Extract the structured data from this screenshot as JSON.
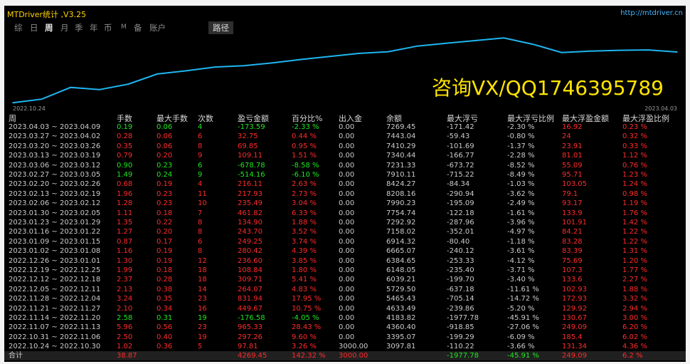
{
  "window": {
    "title": "MTDriver统计 ,V3.25",
    "url": "http://mtdriver.cn"
  },
  "tabs": [
    {
      "label": "综",
      "active": false
    },
    {
      "label": "日",
      "active": false
    },
    {
      "label": "周",
      "active": true
    },
    {
      "label": "月",
      "active": false
    },
    {
      "label": "季",
      "active": false
    },
    {
      "label": "年",
      "active": false
    },
    {
      "label": "币",
      "active": false
    },
    {
      "label": "M",
      "active": false
    },
    {
      "label": "备",
      "active": false
    },
    {
      "label": "账户",
      "active": false
    }
  ],
  "path_button": "路径",
  "chart_data": {
    "type": "line",
    "x_start_label": "2022.10.24",
    "x_end_label": "2023.04.03",
    "line_color": "#1fb5f0",
    "x": [
      "2022.10.24",
      "2022.10.31",
      "2022.11.07",
      "2022.11.14",
      "2022.11.21",
      "2022.11.28",
      "2022.12.05",
      "2022.12.12",
      "2022.12.19",
      "2022.12.26",
      "2023.01.02",
      "2023.01.09",
      "2023.01.16",
      "2023.01.23",
      "2023.01.30",
      "2023.02.06",
      "2023.02.13",
      "2023.02.20",
      "2023.02.27",
      "2023.03.06",
      "2023.03.13",
      "2023.03.20",
      "2023.03.27",
      "2023.04.03"
    ],
    "y": [
      3097.81,
      3395.07,
      4360.4,
      4183.82,
      4633.49,
      5465.43,
      5729.5,
      6039.21,
      6148.05,
      6384.65,
      6665.07,
      6914.32,
      7158.02,
      7292.92,
      7754.74,
      7990.23,
      8208.16,
      8424.27,
      7910.11,
      7231.33,
      7340.44,
      7410.29,
      7443.04,
      7269.45
    ],
    "ylim": [
      3000,
      8500
    ]
  },
  "promo_text": "咨询VX/QQ1746395789",
  "table": {
    "columns": [
      "周",
      "手数",
      "最大手数",
      "次数",
      "盈亏金额",
      "百分比%",
      "出入金",
      "余额",
      "最大浮亏",
      "最大浮亏比例",
      "最大浮盈金额",
      "最大浮盈比例"
    ],
    "rows": [
      {
        "color": "g",
        "cells": [
          "2023.04.03 ~ 2023.04.09",
          "0.19",
          "0.06",
          "4",
          "-173.59",
          "-2.33 %",
          "0.00",
          "7269.45",
          "-171.42",
          "-2.30 %",
          "16.92",
          "0.23 %"
        ]
      },
      {
        "color": "r",
        "cells": [
          "2023.03.27 ~ 2023.04.02",
          "0.28",
          "0.06",
          "6",
          "32.75",
          "0.44 %",
          "0.00",
          "7443.04",
          "-59.43",
          "-0.80 %",
          "24",
          "0.32 %"
        ]
      },
      {
        "color": "r",
        "cells": [
          "2023.03.20 ~ 2023.03.26",
          "0.35",
          "0.06",
          "8",
          "69.85",
          "0.95 %",
          "0.00",
          "7410.29",
          "-101.69",
          "-1.37 %",
          "23.91",
          "0.33 %"
        ]
      },
      {
        "color": "r",
        "cells": [
          "2023.03.13 ~ 2023.03.19",
          "0.79",
          "0.20",
          "9",
          "109.11",
          "1.51 %",
          "0.00",
          "7340.44",
          "-166.77",
          "-2.28 %",
          "81.01",
          "1.12 %"
        ]
      },
      {
        "color": "g",
        "cells": [
          "2023.03.06 ~ 2023.03.12",
          "0.90",
          "0.23",
          "6",
          "-678.78",
          "-8.58 %",
          "0.00",
          "7231.33",
          "-673.72",
          "-8.52 %",
          "55.09",
          "0.76 %"
        ]
      },
      {
        "color": "g",
        "cells": [
          "2023.02.27 ~ 2023.03.05",
          "1.49",
          "0.24",
          "9",
          "-514.16",
          "-6.10 %",
          "0.00",
          "7910.11",
          "-715.22",
          "-8.49 %",
          "95.71",
          "1.23 %"
        ]
      },
      {
        "color": "r",
        "cells": [
          "2023.02.20 ~ 2023.02.26",
          "0.68",
          "0.19",
          "4",
          "216.11",
          "2.63 %",
          "0.00",
          "8424.27",
          "-84.34",
          "-1.03 %",
          "103.05",
          "1.24 %"
        ]
      },
      {
        "color": "r",
        "cells": [
          "2023.02.13 ~ 2023.02.19",
          "1.96",
          "0.23",
          "11",
          "217.93",
          "2.73 %",
          "0.00",
          "8208.16",
          "-290.94",
          "-3.62 %",
          "79.1",
          "0.98 %"
        ]
      },
      {
        "color": "r",
        "cells": [
          "2023.02.06 ~ 2023.02.12",
          "1.28",
          "0.23",
          "10",
          "235.49",
          "3.04 %",
          "0.00",
          "7990.23",
          "-195.09",
          "-2.49 %",
          "93.17",
          "1.19 %"
        ]
      },
      {
        "color": "r",
        "cells": [
          "2023.01.30 ~ 2023.02.05",
          "1.11",
          "0.18",
          "7",
          "461.82",
          "6.33 %",
          "0.00",
          "7754.74",
          "-122.18",
          "-1.61 %",
          "133.9",
          "1.76 %"
        ]
      },
      {
        "color": "r",
        "cells": [
          "2023.01.23 ~ 2023.01.29",
          "1.35",
          "0.22",
          "8",
          "134.90",
          "1.88 %",
          "0.00",
          "7292.92",
          "-287.96",
          "-3.96 %",
          "101.91",
          "1.42 %"
        ]
      },
      {
        "color": "r",
        "cells": [
          "2023.01.16 ~ 2023.01.22",
          "1.27",
          "0.20",
          "8",
          "243.70",
          "3.52 %",
          "0.00",
          "7158.02",
          "-352.01",
          "-4.97 %",
          "84.21",
          "1.22 %"
        ]
      },
      {
        "color": "r",
        "cells": [
          "2023.01.09 ~ 2023.01.15",
          "0.87",
          "0.17",
          "6",
          "249.25",
          "3.74 %",
          "0.00",
          "6914.32",
          "-80.40",
          "-1.18 %",
          "83.28",
          "1.22 %"
        ]
      },
      {
        "color": "r",
        "cells": [
          "2023.01.02 ~ 2023.01.08",
          "1.16",
          "0.19",
          "8",
          "280.42",
          "4.39 %",
          "0.00",
          "6665.07",
          "-240.12",
          "-3.61 %",
          "83.39",
          "1.31 %"
        ]
      },
      {
        "color": "r",
        "cells": [
          "2022.12.26 ~ 2023.01.01",
          "1.30",
          "0.19",
          "12",
          "236.60",
          "3.85 %",
          "0.00",
          "6384.65",
          "-253.33",
          "-4.12 %",
          "75.69",
          "1.20 %"
        ]
      },
      {
        "color": "r",
        "cells": [
          "2022.12.19 ~ 2022.12.25",
          "1.99",
          "0.18",
          "18",
          "108.84",
          "1.80 %",
          "0.00",
          "6148.05",
          "-235.40",
          "-3.71 %",
          "107.3",
          "1.77 %"
        ]
      },
      {
        "color": "r",
        "cells": [
          "2022.12.12 ~ 2022.12.18",
          "2.37",
          "0.28",
          "18",
          "309.71",
          "5.41 %",
          "0.00",
          "6039.21",
          "-199.70",
          "-3.40 %",
          "133.6",
          "2.27 %"
        ]
      },
      {
        "color": "r",
        "cells": [
          "2022.12.05 ~ 2022.12.11",
          "2.13",
          "0.38",
          "14",
          "264.07",
          "4.83 %",
          "0.00",
          "5729.50",
          "-637.18",
          "-11.61 %",
          "102.93",
          "1.88 %"
        ]
      },
      {
        "color": "r",
        "cells": [
          "2022.11.28 ~ 2022.12.04",
          "3.24",
          "0.35",
          "23",
          "831.94",
          "17.95 %",
          "0.00",
          "5465.43",
          "-705.14",
          "-14.72 %",
          "172.93",
          "3.32 %"
        ]
      },
      {
        "color": "r",
        "cells": [
          "2022.11.21 ~ 2022.11.27",
          "2.10",
          "0.34",
          "16",
          "449.67",
          "10.75 %",
          "0.00",
          "4633.49",
          "-239.86",
          "-5.20 %",
          "129.92",
          "2.94 %"
        ]
      },
      {
        "color": "g",
        "cells": [
          "2022.11.14 ~ 2022.11.20",
          "2.58",
          "0.31",
          "19",
          "-176.58",
          "-4.05 %",
          "0.00",
          "4183.82",
          "-1977.78",
          "-45.91 %",
          "130.67",
          "3.00 %"
        ]
      },
      {
        "color": "r",
        "cells": [
          "2022.11.07 ~ 2022.11.13",
          "5.96",
          "0.56",
          "23",
          "965.33",
          "28.43 %",
          "0.00",
          "4360.40",
          "-918.85",
          "-27.06 %",
          "249.09",
          "6.20 %"
        ]
      },
      {
        "color": "r",
        "cells": [
          "2022.10.31 ~ 2022.11.06",
          "2.50",
          "0.40",
          "19",
          "297.26",
          "9.60 %",
          "0.00",
          "3395.07",
          "-199.29",
          "-6.09 %",
          "185.4",
          "6.02 %"
        ]
      },
      {
        "color": "r",
        "cells": [
          "2022.10.24 ~ 2022.10.30",
          "1.02",
          "0.36",
          "5",
          "97.81",
          "3.26 %",
          "3000.00",
          "3097.81",
          "-110.22",
          "-3.66 %",
          "131.34",
          "4.36 %"
        ]
      }
    ],
    "total": {
      "cells": [
        "合计",
        "38.87",
        "",
        "",
        "4269.45",
        "142.32 %",
        "3000.00",
        "",
        "-1977.78",
        "-45.91 %",
        "249.09",
        "6.2 %"
      ]
    }
  }
}
